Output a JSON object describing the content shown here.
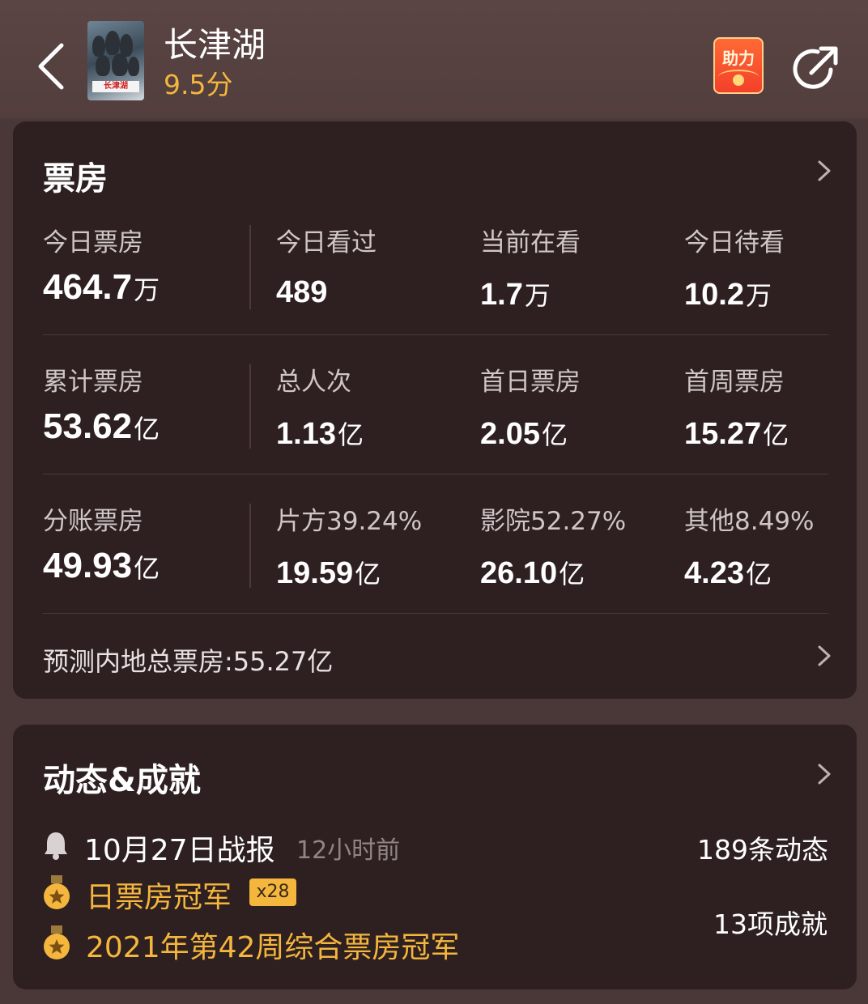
{
  "header": {
    "title": "长津湖",
    "score": "9.5分",
    "poster_title": "长津湖",
    "boost_label": "助力",
    "accent": "#f4b63d",
    "icons": {
      "back": "back-arrow-icon",
      "share": "share-icon"
    }
  },
  "boxoffice": {
    "title": "票房",
    "rows": [
      [
        {
          "label": "今日票房",
          "num": "464.7",
          "unit": "万"
        },
        {
          "label": "今日看过",
          "num": "489",
          "unit": ""
        },
        {
          "label": "当前在看",
          "num": "1.7",
          "unit": "万"
        },
        {
          "label": "今日待看",
          "num": "10.2",
          "unit": "万"
        }
      ],
      [
        {
          "label": "累计票房",
          "num": "53.62",
          "unit": "亿"
        },
        {
          "label": "总人次",
          "num": "1.13",
          "unit": "亿"
        },
        {
          "label": "首日票房",
          "num": "2.05",
          "unit": "亿"
        },
        {
          "label": "首周票房",
          "num": "15.27",
          "unit": "亿"
        }
      ],
      [
        {
          "label": "分账票房",
          "num": "49.93",
          "unit": "亿"
        },
        {
          "label": "片方39.24%",
          "num": "19.59",
          "unit": "亿"
        },
        {
          "label": "影院52.27%",
          "num": "26.10",
          "unit": "亿"
        },
        {
          "label": "其他8.49%",
          "num": "4.23",
          "unit": "亿"
        }
      ]
    ],
    "forecast": "预测内地总票房:55.27亿"
  },
  "news": {
    "title": "动态&成就",
    "report": "10月27日战报",
    "ago": "12小时前",
    "dynamic_count": "189条动态",
    "achievements": [
      {
        "label": "日票房冠军",
        "badge": "x28"
      },
      {
        "label": "2021年第42周综合票房冠军",
        "badge": ""
      }
    ],
    "achievement_count": "13项成就"
  }
}
